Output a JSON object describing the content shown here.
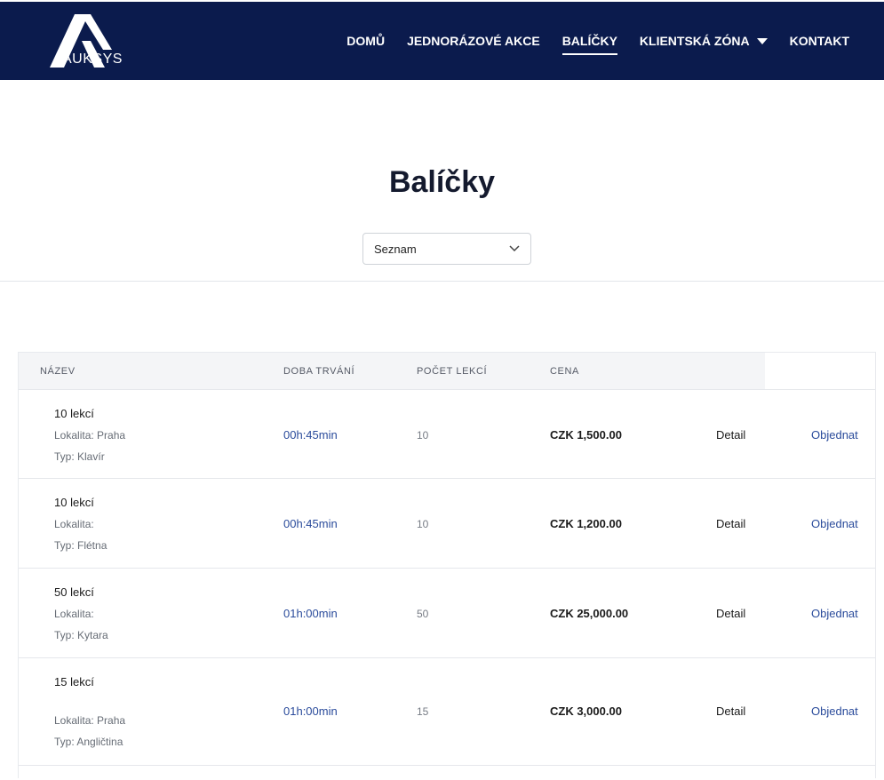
{
  "header": {
    "logo_text": "AUKSYS",
    "nav": [
      {
        "label": "DOMŮ"
      },
      {
        "label": "JEDNORÁZOVÉ AKCE"
      },
      {
        "label": "BALÍČKY"
      },
      {
        "label": "KLIENTSKÁ ZÓNA"
      },
      {
        "label": "KONTAKT"
      }
    ]
  },
  "page": {
    "title": "Balíčky",
    "view_select": {
      "selected": "Seznam"
    }
  },
  "table": {
    "headers": [
      "NÁZEV",
      "DOBA TRVÁNÍ",
      "POČET LEKCÍ",
      "CENA"
    ],
    "rows": [
      {
        "name": "10 lekcí",
        "location": "Lokalita: Praha",
        "type": "Typ: Klavír",
        "duration": "00h:45min",
        "count": "10",
        "price": "CZK 1,500.00",
        "detail": "Detail",
        "order": "Objednat"
      },
      {
        "name": "10 lekcí",
        "location": "Lokalita:",
        "type": "Typ: Flétna",
        "duration": "00h:45min",
        "count": "10",
        "price": "CZK 1,200.00",
        "detail": "Detail",
        "order": "Objednat"
      },
      {
        "name": "50 lekcí",
        "location": "Lokalita:",
        "type": "Typ: Kytara",
        "duration": "01h:00min",
        "count": "50",
        "price": "CZK 25,000.00",
        "detail": "Detail",
        "order": "Objednat"
      },
      {
        "name": "15 lekcí",
        "location": "Lokalita: Praha",
        "type": "Typ: Angličtina",
        "duration": "01h:00min",
        "count": "15",
        "price": "CZK 3,000.00",
        "detail": "Detail",
        "order": "Objednat"
      }
    ]
  },
  "colors": {
    "header_bg": "#0b1b4d",
    "link_blue": "#2a4b9b"
  }
}
